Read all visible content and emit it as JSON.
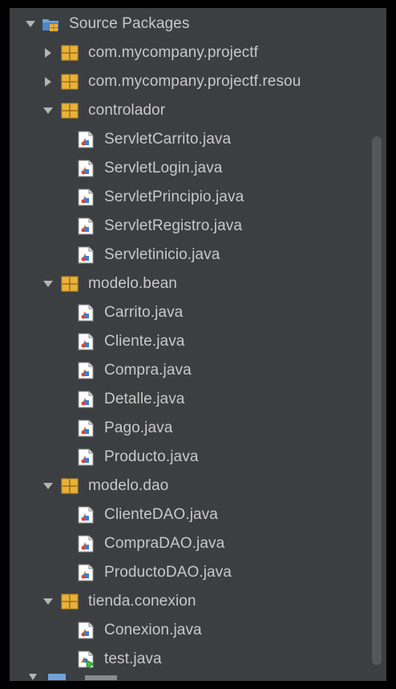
{
  "tree": {
    "root": {
      "label": "Source Packages",
      "icon": "source-packages-icon",
      "expanded": true
    },
    "packages": [
      {
        "label": "com.mycompany.projectf",
        "expanded": false,
        "files": []
      },
      {
        "label": "com.mycompany.projectf.resou",
        "expanded": false,
        "files": []
      },
      {
        "label": "controlador",
        "expanded": true,
        "files": [
          "ServletCarrito.java",
          "ServletLogin.java",
          "ServletPrincipio.java",
          "ServletRegistro.java",
          "Servletinicio.java"
        ]
      },
      {
        "label": "modelo.bean",
        "expanded": true,
        "files": [
          "Carrito.java",
          "Cliente.java",
          "Compra.java",
          "Detalle.java",
          "Pago.java",
          "Producto.java"
        ]
      },
      {
        "label": "modelo.dao",
        "expanded": true,
        "files": [
          "ClienteDAO.java",
          "CompraDAO.java",
          "ProductoDAO.java"
        ]
      },
      {
        "label": "tienda.conexion",
        "expanded": true,
        "files": [
          "Conexion.java",
          "test.java"
        ]
      }
    ]
  },
  "colors": {
    "panel_bg": "#3c3f41",
    "text": "#c8c8c8",
    "package_icon": "#e8b13a",
    "scrollbar": "#555759"
  }
}
